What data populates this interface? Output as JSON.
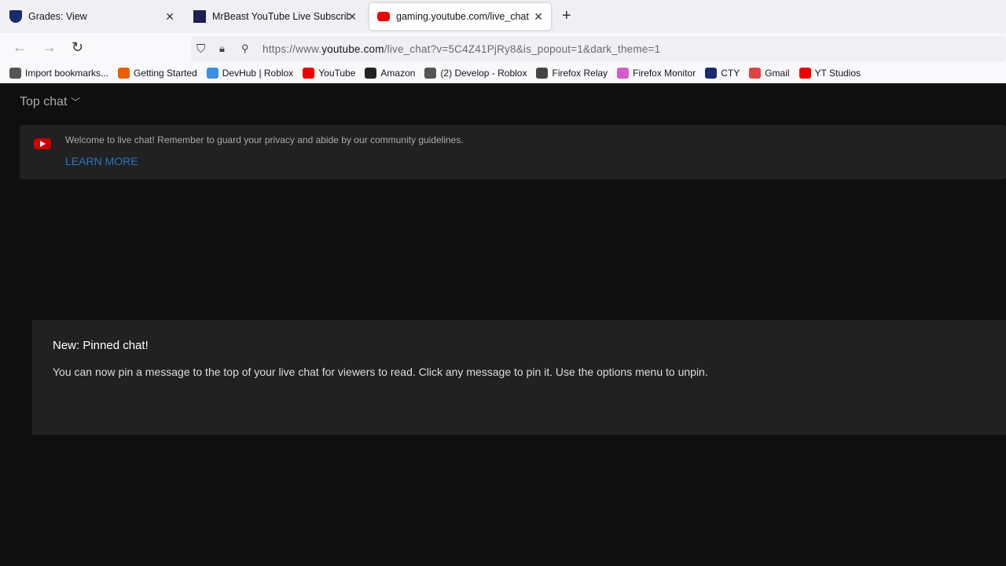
{
  "tabs": [
    {
      "title": "Grades: View",
      "icon": "shield-icon"
    },
    {
      "title": "MrBeast YouTube Live Subscriber",
      "icon": "chart-icon"
    },
    {
      "title": "gaming.youtube.com/live_chat?v=",
      "icon": "youtube-icon",
      "active": true
    }
  ],
  "url": {
    "prefix": "https://www.",
    "host": "youtube.com",
    "path": "/live_chat?v=5C4Z41PjRy8&is_popout=1&dark_theme=1"
  },
  "bookmarks": [
    {
      "label": "Import bookmarks...",
      "icon": "import-icon",
      "color": "#555"
    },
    {
      "label": "Getting Started",
      "icon": "firefox-icon",
      "color": "#e66000"
    },
    {
      "label": "DevHub | Roblox",
      "icon": "devhub-icon",
      "color": "#3a8fe0"
    },
    {
      "label": "YouTube",
      "icon": "youtube-icon",
      "color": "#e00"
    },
    {
      "label": "Amazon",
      "icon": "amazon-icon",
      "color": "#222"
    },
    {
      "label": "(2) Develop - Roblox",
      "icon": "roblox-icon",
      "color": "#555"
    },
    {
      "label": "Firefox Relay",
      "icon": "globe-icon",
      "color": "#444"
    },
    {
      "label": "Firefox Monitor",
      "icon": "monitor-icon",
      "color": "#d45ad0"
    },
    {
      "label": "CTY",
      "icon": "shield-icon",
      "color": "#1a2a6c"
    },
    {
      "label": "Gmail",
      "icon": "gmail-icon",
      "color": "#d44"
    },
    {
      "label": "YT Studios",
      "icon": "youtube-icon",
      "color": "#e00"
    }
  ],
  "chat": {
    "mode": "Top chat",
    "welcome": "Welcome to live chat! Remember to guard your privacy and abide by our community guidelines.",
    "learn_more": "Learn more",
    "pinned_title": "New: Pinned chat!",
    "pinned_text": "You can now pin a message to the top of your live chat for viewers to read. Click any message to pin it. Use the options menu to unpin."
  }
}
